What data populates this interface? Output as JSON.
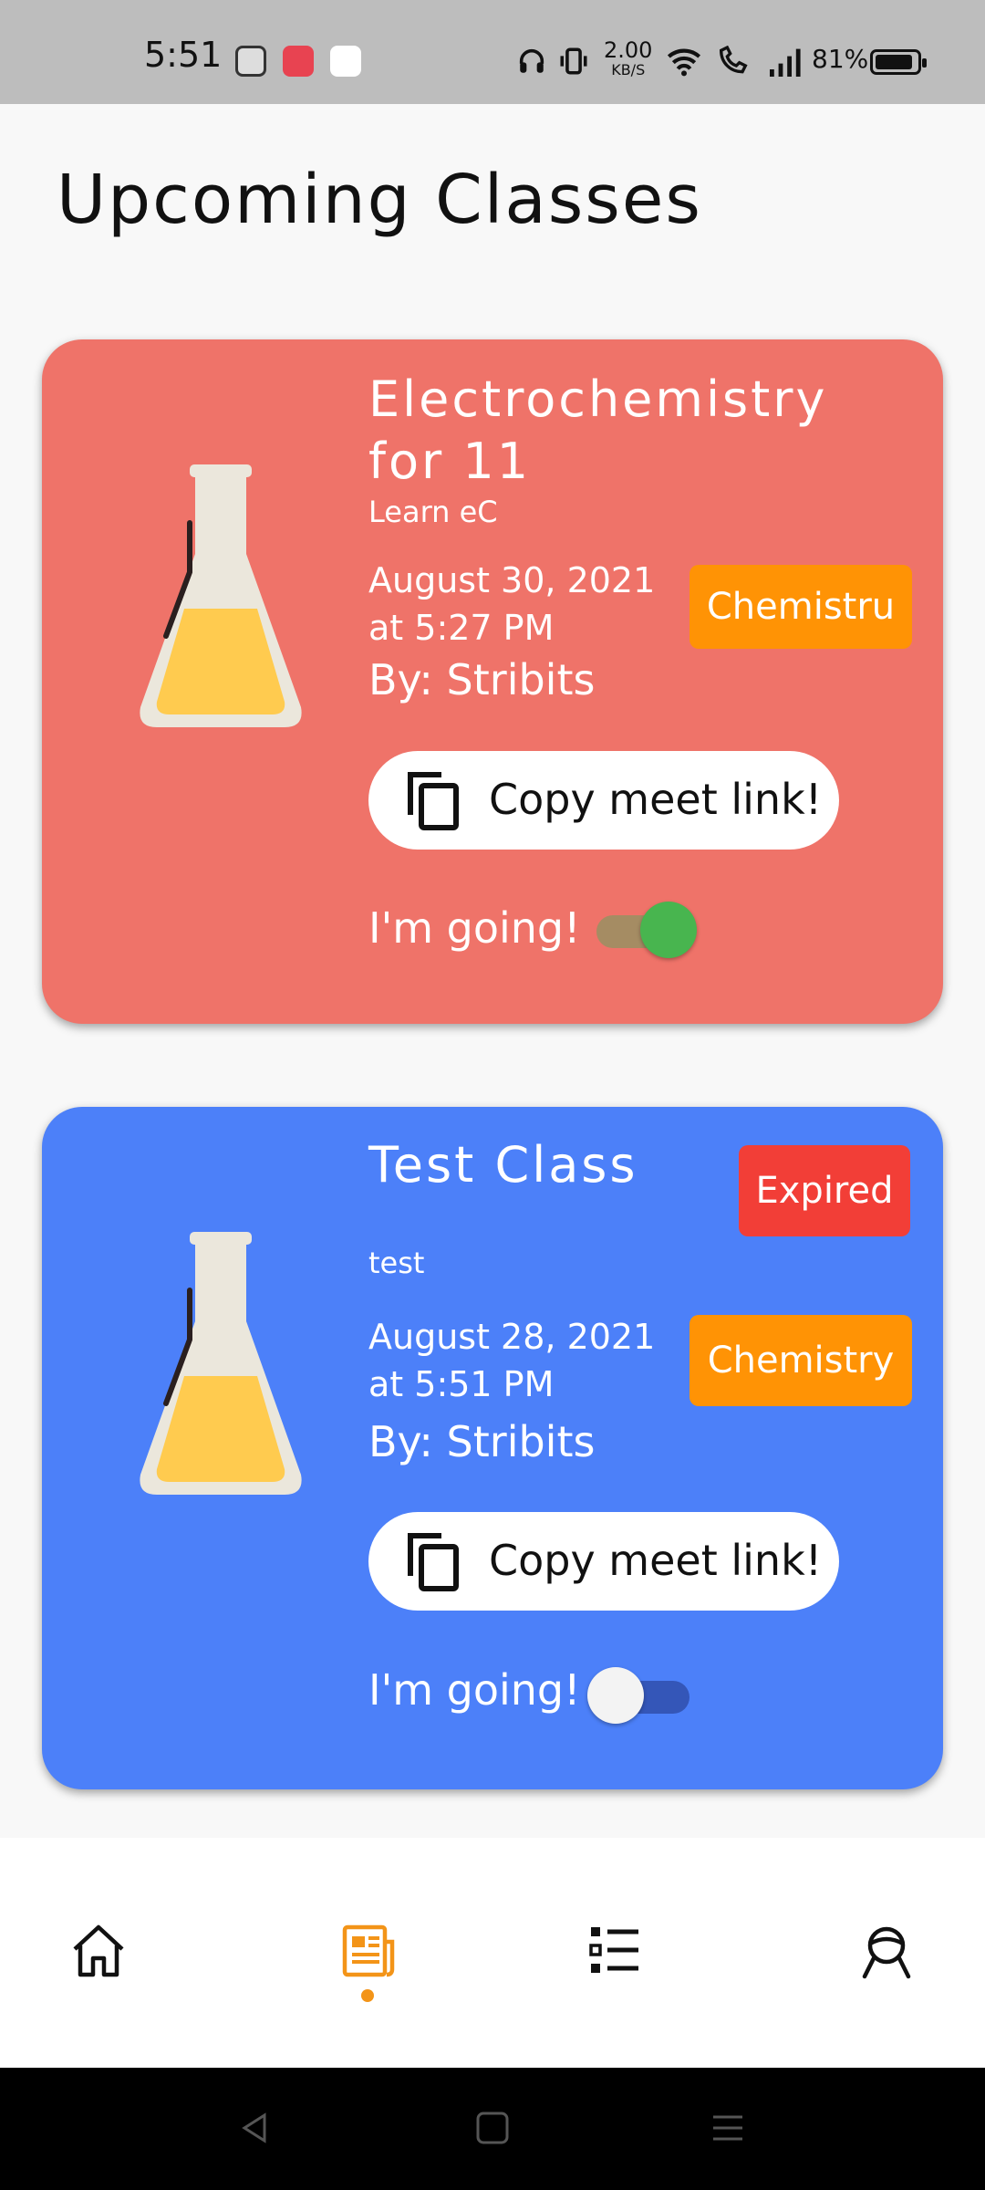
{
  "status_bar": {
    "time": "5:51",
    "speed": "2.00",
    "speed_unit": "KB/S",
    "battery": "81%"
  },
  "page": {
    "title": "Upcoming Classes"
  },
  "classes": [
    {
      "title": "Electrochemistry for 11",
      "subtitle": "Learn eC",
      "date": "August 30, 2021 at 5:27 PM",
      "by": "By: Stribits",
      "subject": "Chemistru",
      "expired_label": "",
      "copy_label": "Copy meet link!",
      "going_label": "I'm going!",
      "going": true,
      "card_color": "#ef7369"
    },
    {
      "title": "Test Class",
      "subtitle": "test",
      "date": "August 28, 2021 at 5:51 PM",
      "by": "By: Stribits",
      "subject": "Chemistry",
      "expired_label": "Expired",
      "copy_label": "Copy meet link!",
      "going_label": "I'm going!",
      "going": false,
      "card_color": "#4c80f9"
    }
  ],
  "bottom_nav": {
    "items": [
      {
        "icon": "home-icon",
        "active": false
      },
      {
        "icon": "news-icon",
        "active": true
      },
      {
        "icon": "list-icon",
        "active": false
      },
      {
        "icon": "profile-icon",
        "active": false
      }
    ],
    "active_color": "#f39418"
  }
}
